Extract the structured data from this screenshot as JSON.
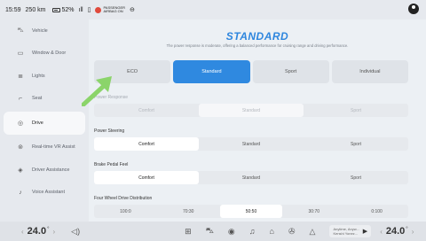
{
  "status": {
    "time": "15:59",
    "range": "250 km",
    "battery_pct": "52%",
    "airbag_line1": "PASSENGER",
    "airbag_line2": "AIRBAG ON"
  },
  "sidebar": {
    "items": [
      {
        "label": "Vehicle",
        "icon": "car-icon"
      },
      {
        "label": "Window & Door",
        "icon": "window-icon"
      },
      {
        "label": "Lights",
        "icon": "light-icon"
      },
      {
        "label": "Seat",
        "icon": "seat-icon"
      },
      {
        "label": "Drive",
        "icon": "steering-wheel-icon"
      },
      {
        "label": "Real-time VR Assist",
        "icon": "vr-icon"
      },
      {
        "label": "Driver Assistance",
        "icon": "assist-icon"
      },
      {
        "label": "Voice Assistant",
        "icon": "voice-icon"
      }
    ],
    "active": "Drive"
  },
  "drive": {
    "mode_title": "STANDARD",
    "mode_desc": "The power response is moderate, offering a balanced performance for cruising range and driving performance.",
    "modes": [
      "ECO",
      "Standard",
      "Sport",
      "Individual"
    ],
    "selected_mode": "Standard",
    "power_response": {
      "title": "Power Response",
      "options": [
        "Comfort",
        "Standard",
        "Sport"
      ],
      "selected": "Standard"
    },
    "power_steering": {
      "title": "Power Steering",
      "options": [
        "Comfort",
        "Standard",
        "Sport"
      ],
      "selected": "Comfort"
    },
    "brake_pedal": {
      "title": "Brake Pedal Feel",
      "options": [
        "Comfort",
        "Standard",
        "Sport"
      ],
      "selected": "Comfort"
    },
    "four_wheel": {
      "title": "Four Wheel Drive Distribution",
      "options": [
        "100:0",
        "70:30",
        "50:50",
        "30:70",
        "0:100"
      ],
      "selected": "50:50"
    }
  },
  "bottom": {
    "temp_left": "24.0",
    "temp_right": "24.0",
    "deg_symbol": "°",
    "media_title": "Anytime, Anyw...",
    "media_sub": "Kenshi Yonez..."
  },
  "colors": {
    "accent": "#2f89e0",
    "arrow": "#8bd46a"
  }
}
